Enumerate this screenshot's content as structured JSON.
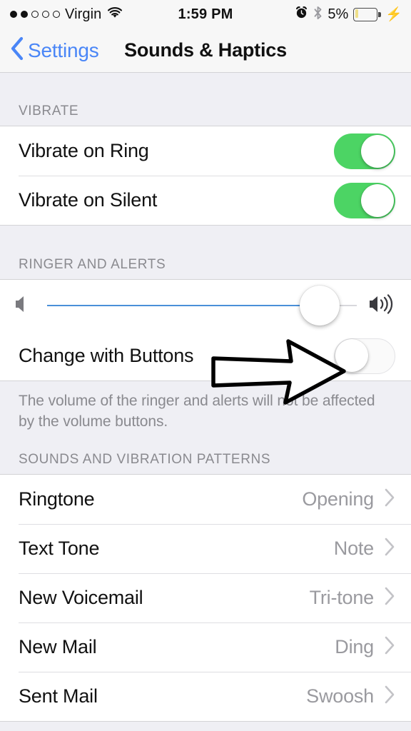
{
  "status_bar": {
    "signal_dots_filled": 2,
    "signal_dots_total": 5,
    "carrier": "Virgin",
    "wifi_icon": "wifi-icon",
    "time": "1:59 PM",
    "alarm_icon": "alarm-clock-icon",
    "bluetooth_icon": "bluetooth-icon",
    "battery_percent": "5%",
    "battery_level": 5,
    "charging_icon": "lightning-bolt-icon",
    "battery_fill_color": "#efe08a"
  },
  "nav": {
    "back_icon": "chevron-left-icon",
    "back_label": "Settings",
    "title": "Sounds & Haptics",
    "tint_color": "#4a86f7"
  },
  "sections": {
    "vibrate": {
      "header": "VIBRATE",
      "rows": [
        {
          "label": "Vibrate on Ring",
          "toggle": "on"
        },
        {
          "label": "Vibrate on Silent",
          "toggle": "on"
        }
      ]
    },
    "ringer": {
      "header": "RINGER AND ALERTS",
      "slider": {
        "min_icon": "speaker-low-icon",
        "max_icon": "speaker-high-icon",
        "value": 88
      },
      "change_with_buttons": {
        "label": "Change with Buttons",
        "toggle": "off"
      },
      "footer": "The volume of the ringer and alerts will not be affected by the volume buttons."
    },
    "patterns": {
      "header": "SOUNDS AND VIBRATION PATTERNS",
      "rows": [
        {
          "label": "Ringtone",
          "value": "Opening",
          "chevron": "chevron-right-icon"
        },
        {
          "label": "Text Tone",
          "value": "Note",
          "chevron": "chevron-right-icon"
        },
        {
          "label": "New Voicemail",
          "value": "Tri-tone",
          "chevron": "chevron-right-icon"
        },
        {
          "label": "New Mail",
          "value": "Ding",
          "chevron": "chevron-right-icon"
        },
        {
          "label": "Sent Mail",
          "value": "Swoosh",
          "chevron": "chevron-right-icon"
        }
      ]
    }
  },
  "annotation": {
    "arrow_icon": "arrow-right-annotation",
    "points_at": "Change with Buttons toggle",
    "color": "#000000"
  },
  "colors": {
    "toggle_on": "#4cd464",
    "group_background": "#ffffff",
    "section_background": "#efeff4",
    "slider_fill": "#4a90d9",
    "secondary_text": "#8a8a8f"
  }
}
